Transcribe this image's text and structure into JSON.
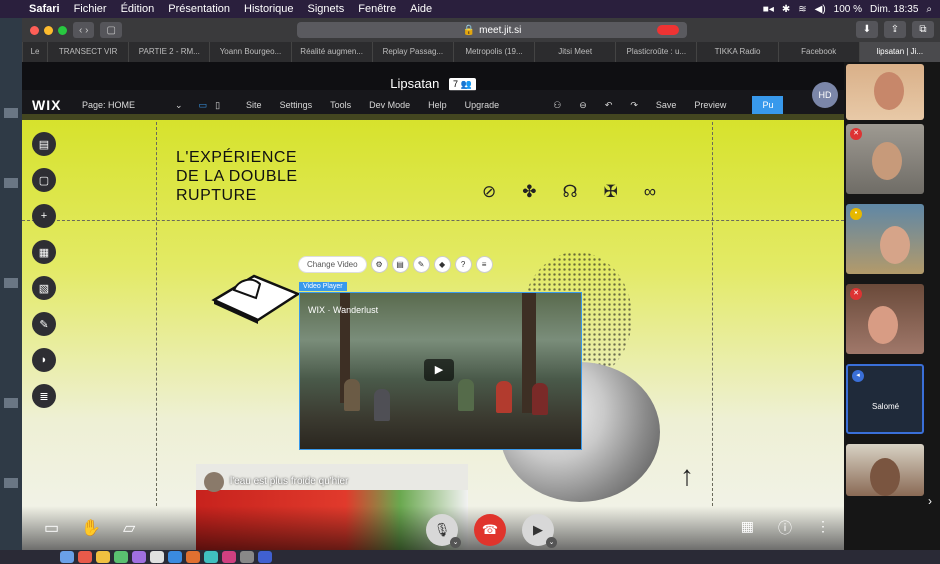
{
  "menubar": {
    "app": "Safari",
    "items": [
      "Fichier",
      "Édition",
      "Présentation",
      "Historique",
      "Signets",
      "Fenêtre",
      "Aide"
    ],
    "battery": "100 %",
    "clock": "Dim. 18:35"
  },
  "browser": {
    "url": "meet.jit.si",
    "tabs": [
      "Le",
      "TRANSECT VIR",
      "PARTIE 2 - RM...",
      "Yoann Bourgeo...",
      "Réalité augmen...",
      "Replay Passag...",
      "Metropolis (19...",
      "Jitsi Meet",
      "Plasticroûte : u...",
      "TIKKA Radio",
      "Facebook",
      "lipsatan | Ji..."
    ]
  },
  "meeting": {
    "title": "Lipsatan",
    "participants": "7",
    "avatar_initials": "HD"
  },
  "wix": {
    "logo": "WIX",
    "page_label": "Page: HOME",
    "menu": [
      "Site",
      "Settings",
      "Tools",
      "Dev Mode",
      "Help",
      "Upgrade"
    ],
    "save": "Save",
    "preview": "Preview",
    "publish": "Pu",
    "headline": [
      "L'EXPÉRIENCE",
      "DE LA DOUBLE",
      "RUPTURE"
    ],
    "change_video": "Change Video",
    "video_player_label": "Video Player",
    "video_title": "WIX · Wanderlust",
    "bottom_card_text": "l'eau est plus froide qu'hier"
  },
  "filmstrip": {
    "participant_name": "Salomé"
  },
  "colors": {
    "accent": "#3899ec",
    "hangup": "#e0342c",
    "wix_yellow": "#d6e22a"
  }
}
